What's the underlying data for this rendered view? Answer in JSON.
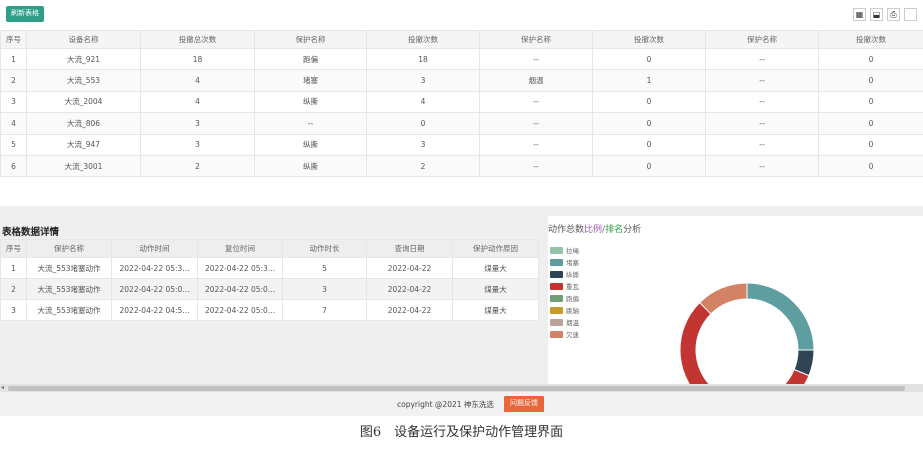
{
  "toolbar": {
    "refresh_label": "刷新表格",
    "icons": [
      "columns-icon",
      "export-icon",
      "print-icon",
      "blank-icon"
    ]
  },
  "top_table": {
    "headers": [
      "序号",
      "设备名称",
      "投撤总次数",
      "保护名称",
      "投撤次数",
      "保护名称",
      "投撤次数",
      "保护名称",
      "投撤次数"
    ],
    "rows": [
      [
        "1",
        "大流_921",
        "18",
        "跑偏",
        "18",
        "--",
        "0",
        "--",
        "0"
      ],
      [
        "2",
        "大流_553",
        "4",
        "堵塞",
        "3",
        "烟温",
        "1",
        "--",
        "0"
      ],
      [
        "3",
        "大流_2004",
        "4",
        "纵撕",
        "4",
        "--",
        "0",
        "--",
        "0"
      ],
      [
        "4",
        "大流_806",
        "3",
        "--",
        "0",
        "--",
        "0",
        "--",
        "0"
      ],
      [
        "5",
        "大流_947",
        "3",
        "纵撕",
        "3",
        "--",
        "0",
        "--",
        "0"
      ],
      [
        "6",
        "大流_3001",
        "2",
        "纵撕",
        "2",
        "--",
        "0",
        "--",
        "0"
      ]
    ]
  },
  "detail": {
    "title": "表格数据详情",
    "headers": [
      "序号",
      "保护名称",
      "动作时间",
      "复位时间",
      "动作时长",
      "查询日期",
      "保护动作原因"
    ],
    "rows": [
      [
        "1",
        "大流_553堵塞动作",
        "2022-04-22 05:3...",
        "2022-04-22 05:3...",
        "5",
        "2022-04-22",
        "煤量大"
      ],
      [
        "2",
        "大流_553堵塞动作",
        "2022-04-22 05:0...",
        "2022-04-22 05:0...",
        "3",
        "2022-04-22",
        "煤量大"
      ],
      [
        "3",
        "大流_553堵塞动作",
        "2022-04-22 04:5...",
        "2022-04-22 05:0...",
        "7",
        "2022-04-22",
        "煤量大"
      ]
    ]
  },
  "chart": {
    "title_part1": "动作总数",
    "title_part2": "比例",
    "title_part3": "/",
    "title_part4": "排名",
    "title_part5": "分析"
  },
  "chart_data": {
    "type": "pie",
    "legend_placement": "left",
    "categories": [
      "拉绳",
      "堵塞",
      "纵撕",
      "重瓦",
      "跑偏",
      "跳轴",
      "烟温",
      "欠速"
    ],
    "colors": [
      "#93c5a8",
      "#5e9ea0",
      "#2f4554",
      "#c23531",
      "#6e9f79",
      "#c89a2a",
      "#bda29a",
      "#d48265"
    ],
    "values": [
      0,
      4,
      1,
      9,
      0,
      0,
      0,
      2
    ]
  },
  "footer": {
    "copyright": "copyright @2021 神东洗选",
    "feedback_label": "问题反馈"
  },
  "caption": "图6　设备运行及保护动作管理界面"
}
